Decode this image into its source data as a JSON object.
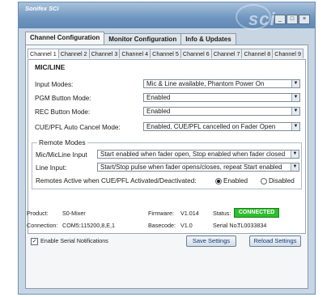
{
  "window": {
    "app_title": "Sonifex SCi",
    "logo_text": "sci",
    "controls": [
      "_",
      "□",
      "×"
    ]
  },
  "main_tabs": [
    "Channel Configuration",
    "Monitor Configuration",
    "Info & Updates"
  ],
  "channel_tabs": [
    "Channel 1",
    "Channel 2",
    "Channel 3",
    "Channel 4",
    "Channel 5",
    "Channel 6",
    "Channel 7",
    "Channel 8",
    "Channel 9"
  ],
  "section": {
    "title": "MIC/LINE",
    "rows": [
      {
        "label": "Input Modes:",
        "value": "Mic & Line available, Phantom Power On"
      },
      {
        "label": "PGM Button Mode:",
        "value": "Enabled"
      },
      {
        "label": "REC Button Mode:",
        "value": "Enabled"
      },
      {
        "label": "CUE/PFL Auto Cancel Mode:",
        "value": "Enabled, CUE/PFL cancelled on Fader Open"
      }
    ]
  },
  "remote_modes": {
    "title": "Remote Modes",
    "micline_label": "Mic/MicLine Input",
    "micline_value": "Start enabled when fader open, Stop enabled when fader closed",
    "line_label": "Line Input:",
    "line_value": "Start/Stop pulse when fader opens/closes, repeat Start enabled",
    "cue_label": "Remotes Active when CUE/PFL Activated/Deactivated:",
    "enabled_label": "Enabled",
    "disabled_label": "Disabled"
  },
  "serial_checkbox": "Enable Serial Notifications",
  "buttons": {
    "save": "Save Settings",
    "reload": "Reload Settings"
  },
  "footer": {
    "product_label": "Product:",
    "product_value": "S0-Mixer",
    "firmware_label": "Firmware:",
    "firmware_value": "V1.014",
    "status_label": "Status:",
    "status_value": "CONNECTED",
    "connection_label": "Connection:",
    "connection_value": "COM5:115200,8,E,1",
    "basecode_label": "Basecode:",
    "basecode_value": "V1.0",
    "serial_label": "Serial No.:",
    "serial_value": "TL0033834"
  },
  "colors": {
    "status_connected": "#2ebd2e",
    "title_bar": "#6f96bf"
  }
}
